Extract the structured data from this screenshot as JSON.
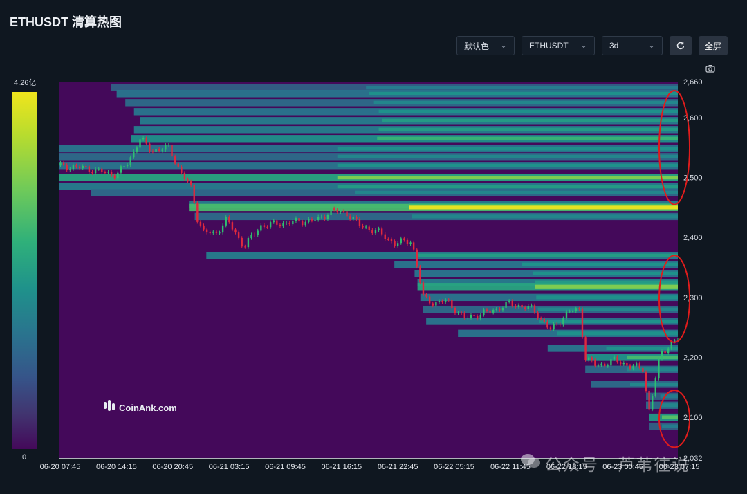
{
  "header": {
    "title": "ETHUSDT 清算热图"
  },
  "toolbar": {
    "color_scheme": "默认色",
    "symbol": "ETHUSDT",
    "range": "3d",
    "refresh_icon": "refresh-icon",
    "fullscreen_label": "全屏",
    "camera_icon": "camera-icon"
  },
  "colorbar": {
    "max_label": "4.26亿",
    "min_label": "0"
  },
  "brand": {
    "name": "CoinAnk.com"
  },
  "watermark": {
    "text": "公众号 · 芦苇往说"
  },
  "colors": {
    "background": "#0f1720",
    "heatmap_low": "#44095a",
    "heatmap_high": "#f0e51c",
    "candle_up": "#2fbf71",
    "candle_down": "#e0293e",
    "annotation": "#e01c1c"
  },
  "chart_data": {
    "type": "heatmap",
    "title": "ETHUSDT 清算热图",
    "x_ticks": [
      "06-20 07:45",
      "06-20 14:15",
      "06-20 20:45",
      "06-21 03:15",
      "06-21 09:45",
      "06-21 16:15",
      "06-21 22:45",
      "06-22 05:15",
      "06-22 11:45",
      "06-22 18:15",
      "06-23 00:45",
      "06-23 07:15"
    ],
    "y_ticks": [
      2660,
      2600,
      2500,
      2400,
      2300,
      2200,
      2100,
      2032
    ],
    "y_tick_labels": [
      "2,660",
      "2,600",
      "2,500",
      "2,400",
      "2,300",
      "2,200",
      "2,100",
      "2,032"
    ],
    "ylim": [
      2032,
      2660
    ],
    "colorbar_range": [
      0,
      426000000
    ],
    "price_path": [
      {
        "t": 0,
        "p": 2520
      },
      {
        "t": 5,
        "p": 2515
      },
      {
        "t": 8,
        "p": 2508
      },
      {
        "t": 10,
        "p": 2505
      },
      {
        "t": 12,
        "p": 2525
      },
      {
        "t": 14,
        "p": 2565
      },
      {
        "t": 16,
        "p": 2545
      },
      {
        "t": 19,
        "p": 2550
      },
      {
        "t": 21,
        "p": 2510
      },
      {
        "t": 23,
        "p": 2480
      },
      {
        "t": 24,
        "p": 2430
      },
      {
        "t": 25,
        "p": 2410
      },
      {
        "t": 27,
        "p": 2405
      },
      {
        "t": 29,
        "p": 2430
      },
      {
        "t": 32,
        "p": 2385
      },
      {
        "t": 35,
        "p": 2420
      },
      {
        "t": 40,
        "p": 2425
      },
      {
        "t": 45,
        "p": 2430
      },
      {
        "t": 47,
        "p": 2445
      },
      {
        "t": 50,
        "p": 2440
      },
      {
        "t": 52,
        "p": 2420
      },
      {
        "t": 55,
        "p": 2410
      },
      {
        "t": 58,
        "p": 2390
      },
      {
        "t": 61,
        "p": 2395
      },
      {
        "t": 63,
        "p": 2300
      },
      {
        "t": 65,
        "p": 2290
      },
      {
        "t": 67,
        "p": 2295
      },
      {
        "t": 70,
        "p": 2265
      },
      {
        "t": 74,
        "p": 2275
      },
      {
        "t": 78,
        "p": 2290
      },
      {
        "t": 82,
        "p": 2280
      },
      {
        "t": 85,
        "p": 2245
      },
      {
        "t": 88,
        "p": 2275
      },
      {
        "t": 90,
        "p": 2280
      },
      {
        "t": 91,
        "p": 2200
      },
      {
        "t": 93,
        "p": 2185
      },
      {
        "t": 96,
        "p": 2195
      },
      {
        "t": 99,
        "p": 2185
      },
      {
        "t": 101,
        "p": 2180
      },
      {
        "t": 102,
        "p": 2110
      },
      {
        "t": 104,
        "p": 2205
      },
      {
        "t": 106,
        "p": 2225
      },
      {
        "t": 107,
        "p": 2230
      }
    ],
    "liquidation_levels": [
      {
        "price": 2650,
        "intensity": 0.45
      },
      {
        "price": 2640,
        "intensity": 0.55
      },
      {
        "price": 2625,
        "intensity": 0.5
      },
      {
        "price": 2610,
        "intensity": 0.55
      },
      {
        "price": 2595,
        "intensity": 0.6
      },
      {
        "price": 2580,
        "intensity": 0.6
      },
      {
        "price": 2565,
        "intensity": 0.72
      },
      {
        "price": 2548,
        "intensity": 0.55
      },
      {
        "price": 2535,
        "intensity": 0.5
      },
      {
        "price": 2520,
        "intensity": 0.55
      },
      {
        "price": 2500,
        "intensity": 0.85
      },
      {
        "price": 2485,
        "intensity": 0.6
      },
      {
        "price": 2475,
        "intensity": 0.5
      },
      {
        "price": 2455,
        "intensity": 0.6
      },
      {
        "price": 2450,
        "intensity": 1.0
      },
      {
        "price": 2435,
        "intensity": 0.5
      },
      {
        "price": 2370,
        "intensity": 0.6
      },
      {
        "price": 2355,
        "intensity": 0.55
      },
      {
        "price": 2340,
        "intensity": 0.55
      },
      {
        "price": 2325,
        "intensity": 0.6
      },
      {
        "price": 2318,
        "intensity": 0.85
      },
      {
        "price": 2300,
        "intensity": 0.55
      },
      {
        "price": 2280,
        "intensity": 0.5
      },
      {
        "price": 2260,
        "intensity": 0.55
      },
      {
        "price": 2240,
        "intensity": 0.55
      },
      {
        "price": 2215,
        "intensity": 0.55
      },
      {
        "price": 2200,
        "intensity": 0.75
      },
      {
        "price": 2180,
        "intensity": 0.5
      },
      {
        "price": 2155,
        "intensity": 0.5
      },
      {
        "price": 2135,
        "intensity": 0.45
      },
      {
        "price": 2120,
        "intensity": 0.5
      },
      {
        "price": 2100,
        "intensity": 0.78
      },
      {
        "price": 2085,
        "intensity": 0.45
      },
      {
        "price": 2070,
        "intensity": 0.4
      },
      {
        "price": 2055,
        "intensity": 0.4
      }
    ],
    "annotations": [
      {
        "shape": "ellipse",
        "price_range": [
          2455,
          2645
        ],
        "color": "#e01c1c"
      },
      {
        "shape": "ellipse",
        "price_range": [
          2225,
          2370
        ],
        "color": "#e01c1c"
      },
      {
        "shape": "ellipse",
        "price_range": [
          2050,
          2145
        ],
        "color": "#e01c1c"
      }
    ]
  }
}
